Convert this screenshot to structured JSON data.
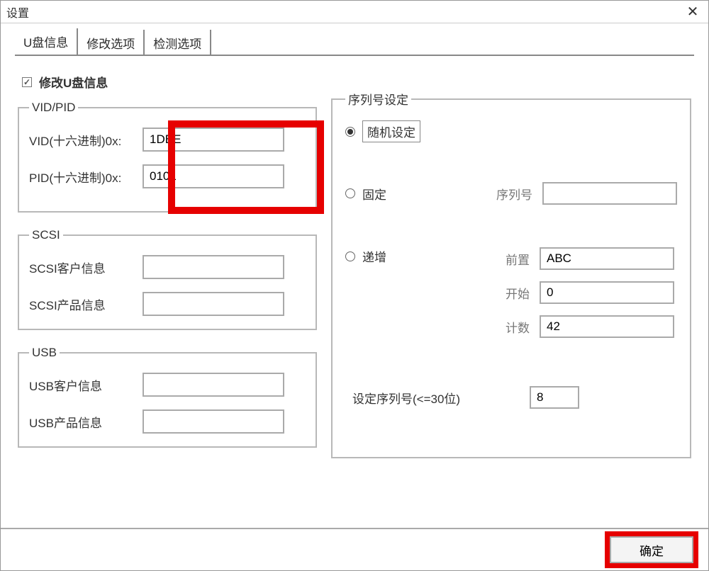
{
  "window": {
    "title": "设置"
  },
  "tabs": {
    "items": [
      "U盘信息",
      "修改选项",
      "检测选项"
    ]
  },
  "checkbox": {
    "modify_label": "修改U盘信息",
    "modify_checked": "✓"
  },
  "vidpid": {
    "legend": "VID/PID",
    "vid_label": "VID(十六进制)0x:",
    "vid_value": "1DBE",
    "pid_label": "PID(十六进制)0x:",
    "pid_value": "0101"
  },
  "scsi": {
    "legend": "SCSI",
    "customer_label": "SCSI客户信息",
    "customer_value": "",
    "product_label": "SCSI产品信息",
    "product_value": ""
  },
  "usb": {
    "legend": "USB",
    "customer_label": "USB客户信息",
    "customer_value": "",
    "product_label": "USB产品信息",
    "product_value": ""
  },
  "serial": {
    "legend": "序列号设定",
    "random_label": "随机设定",
    "fixed_label": "固定",
    "fixed_serial_label": "序列号",
    "fixed_serial_value": "",
    "incr_label": "递增",
    "prefix_label": "前置",
    "prefix_value": "ABC",
    "start_label": "开始",
    "start_value": "0",
    "count_label": "计数",
    "count_value": "42",
    "len_label": "设定序列号(<=30位)",
    "len_value": "8"
  },
  "buttons": {
    "ok": "确定"
  }
}
